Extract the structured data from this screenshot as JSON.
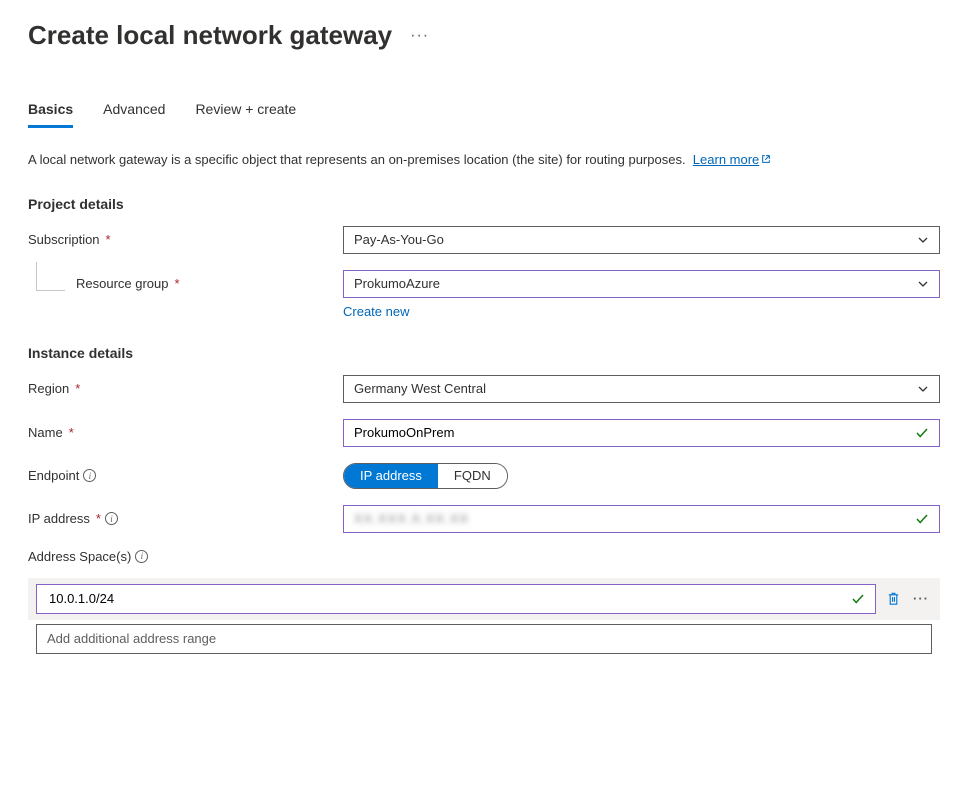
{
  "page_title": "Create local network gateway",
  "tabs": [
    {
      "label": "Basics",
      "active": true
    },
    {
      "label": "Advanced",
      "active": false
    },
    {
      "label": "Review + create",
      "active": false
    }
  ],
  "description_text": "A local network gateway is a specific object that represents an on-premises location (the site) for routing purposes.",
  "learn_more_label": "Learn more",
  "sections": {
    "project": {
      "title": "Project details",
      "subscription": {
        "label": "Subscription",
        "value": "Pay-As-You-Go",
        "required": true
      },
      "resource_group": {
        "label": "Resource group",
        "value": "ProkumoAzure",
        "required": true,
        "create_new": "Create new"
      }
    },
    "instance": {
      "title": "Instance details",
      "region": {
        "label": "Region",
        "value": "Germany West Central",
        "required": true
      },
      "name": {
        "label": "Name",
        "value": "ProkumoOnPrem",
        "required": true
      },
      "endpoint": {
        "label": "Endpoint",
        "options": [
          "IP address",
          "FQDN"
        ],
        "selected": "IP address"
      },
      "ip": {
        "label": "IP address",
        "value": "XX.XXX.X.XX.XX",
        "required": true
      },
      "address_spaces": {
        "label": "Address Space(s)",
        "items": [
          "10.0.1.0/24"
        ],
        "placeholder": "Add additional address range"
      }
    }
  }
}
